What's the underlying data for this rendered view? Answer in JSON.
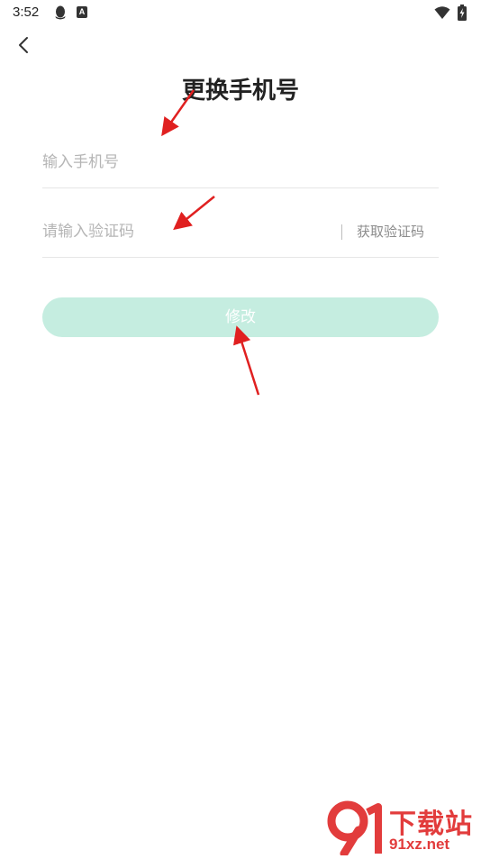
{
  "status_bar": {
    "time": "3:52",
    "icons": [
      "qq-notification-icon",
      "a-notification-icon",
      "wifi-icon",
      "battery-charging-icon"
    ]
  },
  "header": {
    "back_icon": "chevron-left-icon",
    "title": "更换手机号"
  },
  "form": {
    "phone_placeholder": "输入手机号",
    "phone_value": "",
    "code_placeholder": "请输入验证码",
    "code_value": "",
    "get_code_label": "获取验证码",
    "submit_label": "修改"
  },
  "watermark": {
    "site_name": "下载站",
    "url": "91xz.net"
  },
  "colors": {
    "submit_button": "#c5ede0",
    "submit_text": "#ffffff",
    "annotation_arrow": "#e02020",
    "watermark": "#e23c3c"
  }
}
